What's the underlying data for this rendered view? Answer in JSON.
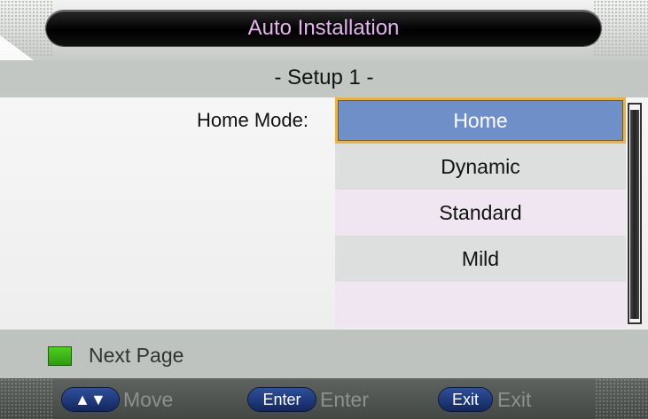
{
  "header": {
    "title": "Auto Installation"
  },
  "setup": {
    "subtitle": "- Setup 1 -"
  },
  "form": {
    "label": "Home Mode:",
    "options": [
      "Home",
      "Dynamic",
      "Standard",
      "Mild"
    ],
    "selected": "Home"
  },
  "hint": {
    "next_page": "Next Page",
    "color": "#3fbe18"
  },
  "footer": {
    "move_key": "▲▼",
    "move_label": "Move",
    "enter_key": "Enter",
    "enter_label": "Enter",
    "exit_key": "Exit",
    "exit_label": "Exit"
  }
}
